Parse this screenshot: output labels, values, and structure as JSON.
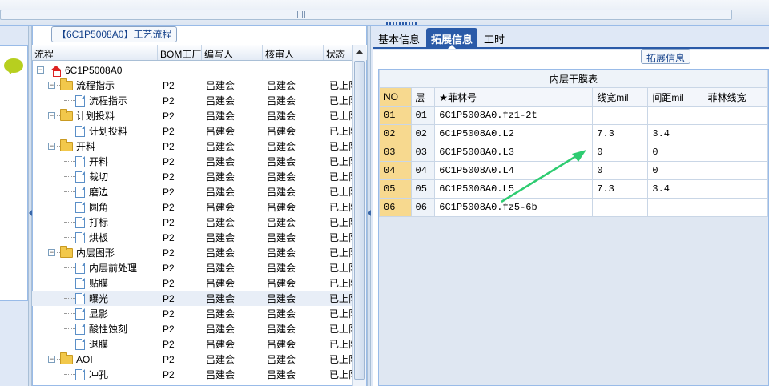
{
  "tree_panel": {
    "title": "【6C1P5008A0】工艺流程",
    "columns": [
      "流程",
      "BOM工厂",
      "编写人",
      "核审人",
      "状态"
    ],
    "root": "6C1P5008A0",
    "rows": [
      {
        "label": "流程指示",
        "type": "folder",
        "bom": "P2",
        "writer": "吕建会",
        "reviewer": "吕建会",
        "status": "已上队"
      },
      {
        "label": "流程指示",
        "type": "file",
        "bom": "P2",
        "writer": "吕建会",
        "reviewer": "吕建会",
        "status": "已上队"
      },
      {
        "label": "计划投料",
        "type": "folder",
        "bom": "P2",
        "writer": "吕建会",
        "reviewer": "吕建会",
        "status": "已上队"
      },
      {
        "label": "计划投料",
        "type": "file",
        "bom": "P2",
        "writer": "吕建会",
        "reviewer": "吕建会",
        "status": "已上队"
      },
      {
        "label": "开料",
        "type": "folder",
        "bom": "P2",
        "writer": "吕建会",
        "reviewer": "吕建会",
        "status": "已上队"
      },
      {
        "label": "开料",
        "type": "file",
        "bom": "P2",
        "writer": "吕建会",
        "reviewer": "吕建会",
        "status": "已上队"
      },
      {
        "label": "裁切",
        "type": "file",
        "bom": "P2",
        "writer": "吕建会",
        "reviewer": "吕建会",
        "status": "已上队"
      },
      {
        "label": "磨边",
        "type": "file",
        "bom": "P2",
        "writer": "吕建会",
        "reviewer": "吕建会",
        "status": "已上队"
      },
      {
        "label": "圆角",
        "type": "file",
        "bom": "P2",
        "writer": "吕建会",
        "reviewer": "吕建会",
        "status": "已上队"
      },
      {
        "label": "打标",
        "type": "file",
        "bom": "P2",
        "writer": "吕建会",
        "reviewer": "吕建会",
        "status": "已上队"
      },
      {
        "label": "烘板",
        "type": "file",
        "bom": "P2",
        "writer": "吕建会",
        "reviewer": "吕建会",
        "status": "已上队"
      },
      {
        "label": "内层图形",
        "type": "folder",
        "bom": "P2",
        "writer": "吕建会",
        "reviewer": "吕建会",
        "status": "已上队"
      },
      {
        "label": "内层前处理",
        "type": "file",
        "bom": "P2",
        "writer": "吕建会",
        "reviewer": "吕建会",
        "status": "已上队"
      },
      {
        "label": "贴膜",
        "type": "file",
        "bom": "P2",
        "writer": "吕建会",
        "reviewer": "吕建会",
        "status": "已上队"
      },
      {
        "label": "曝光",
        "type": "file",
        "bom": "P2",
        "writer": "吕建会",
        "reviewer": "吕建会",
        "status": "已上队",
        "selected": true
      },
      {
        "label": "显影",
        "type": "file",
        "bom": "P2",
        "writer": "吕建会",
        "reviewer": "吕建会",
        "status": "已上队"
      },
      {
        "label": "酸性蚀刻",
        "type": "file",
        "bom": "P2",
        "writer": "吕建会",
        "reviewer": "吕建会",
        "status": "已上队"
      },
      {
        "label": "退膜",
        "type": "file",
        "bom": "P2",
        "writer": "吕建会",
        "reviewer": "吕建会",
        "status": "已上队"
      },
      {
        "label": "AOI",
        "type": "folder",
        "bom": "P2",
        "writer": "吕建会",
        "reviewer": "吕建会",
        "status": "已上队"
      },
      {
        "label": "冲孔",
        "type": "file",
        "bom": "P2",
        "writer": "吕建会",
        "reviewer": "吕建会",
        "status": "已上队"
      }
    ]
  },
  "tabs": [
    "基本信息",
    "拓展信息",
    "工时"
  ],
  "active_tab": "拓展信息",
  "group_label": "拓展信息",
  "table": {
    "caption": "内层干膜表",
    "columns": [
      "NO",
      "层",
      "★菲林号",
      "线宽mil",
      "间距mil",
      "菲林线宽"
    ],
    "rows": [
      [
        "01",
        "01",
        "6C1P5008A0.fz1-2t",
        "",
        "",
        ""
      ],
      [
        "02",
        "02",
        "6C1P5008A0.L2",
        "7.3",
        "3.4",
        ""
      ],
      [
        "03",
        "03",
        "6C1P5008A0.L3",
        "0",
        "0",
        ""
      ],
      [
        "04",
        "04",
        "6C1P5008A0.L4",
        "0",
        "0",
        ""
      ],
      [
        "05",
        "05",
        "6C1P5008A0.L5",
        "7.3",
        "3.4",
        ""
      ],
      [
        "06",
        "06",
        "6C1P5008A0.fz5-6b",
        "",
        "",
        ""
      ]
    ]
  },
  "colors": {
    "accent": "#2a5aa8",
    "no_column": "#f7d98f",
    "annotation_arrow": "#2ecc71"
  }
}
